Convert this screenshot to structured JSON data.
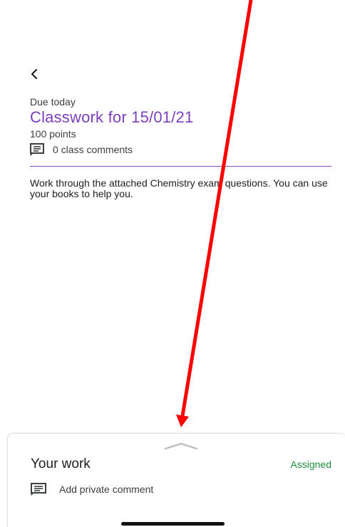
{
  "header": {
    "back_icon": "chevron-left-icon"
  },
  "assignment": {
    "due_label": "Due today",
    "title": "Classwork for 15/01/21",
    "points": "100 points",
    "class_comments": "0 class comments",
    "comment_icon": "comment-icon",
    "description": "Work through the attached Chemistry exam questions. You can use your books to help you.",
    "accent_color": "#7b3fbf"
  },
  "your_work": {
    "title": "Your work",
    "status": "Assigned",
    "status_color": "#1e8e3e",
    "private_comment": "Add private comment",
    "private_comment_icon": "comment-icon",
    "expand_icon": "chevron-up-icon"
  },
  "annotation": {
    "arrow_color": "#ff0000"
  }
}
